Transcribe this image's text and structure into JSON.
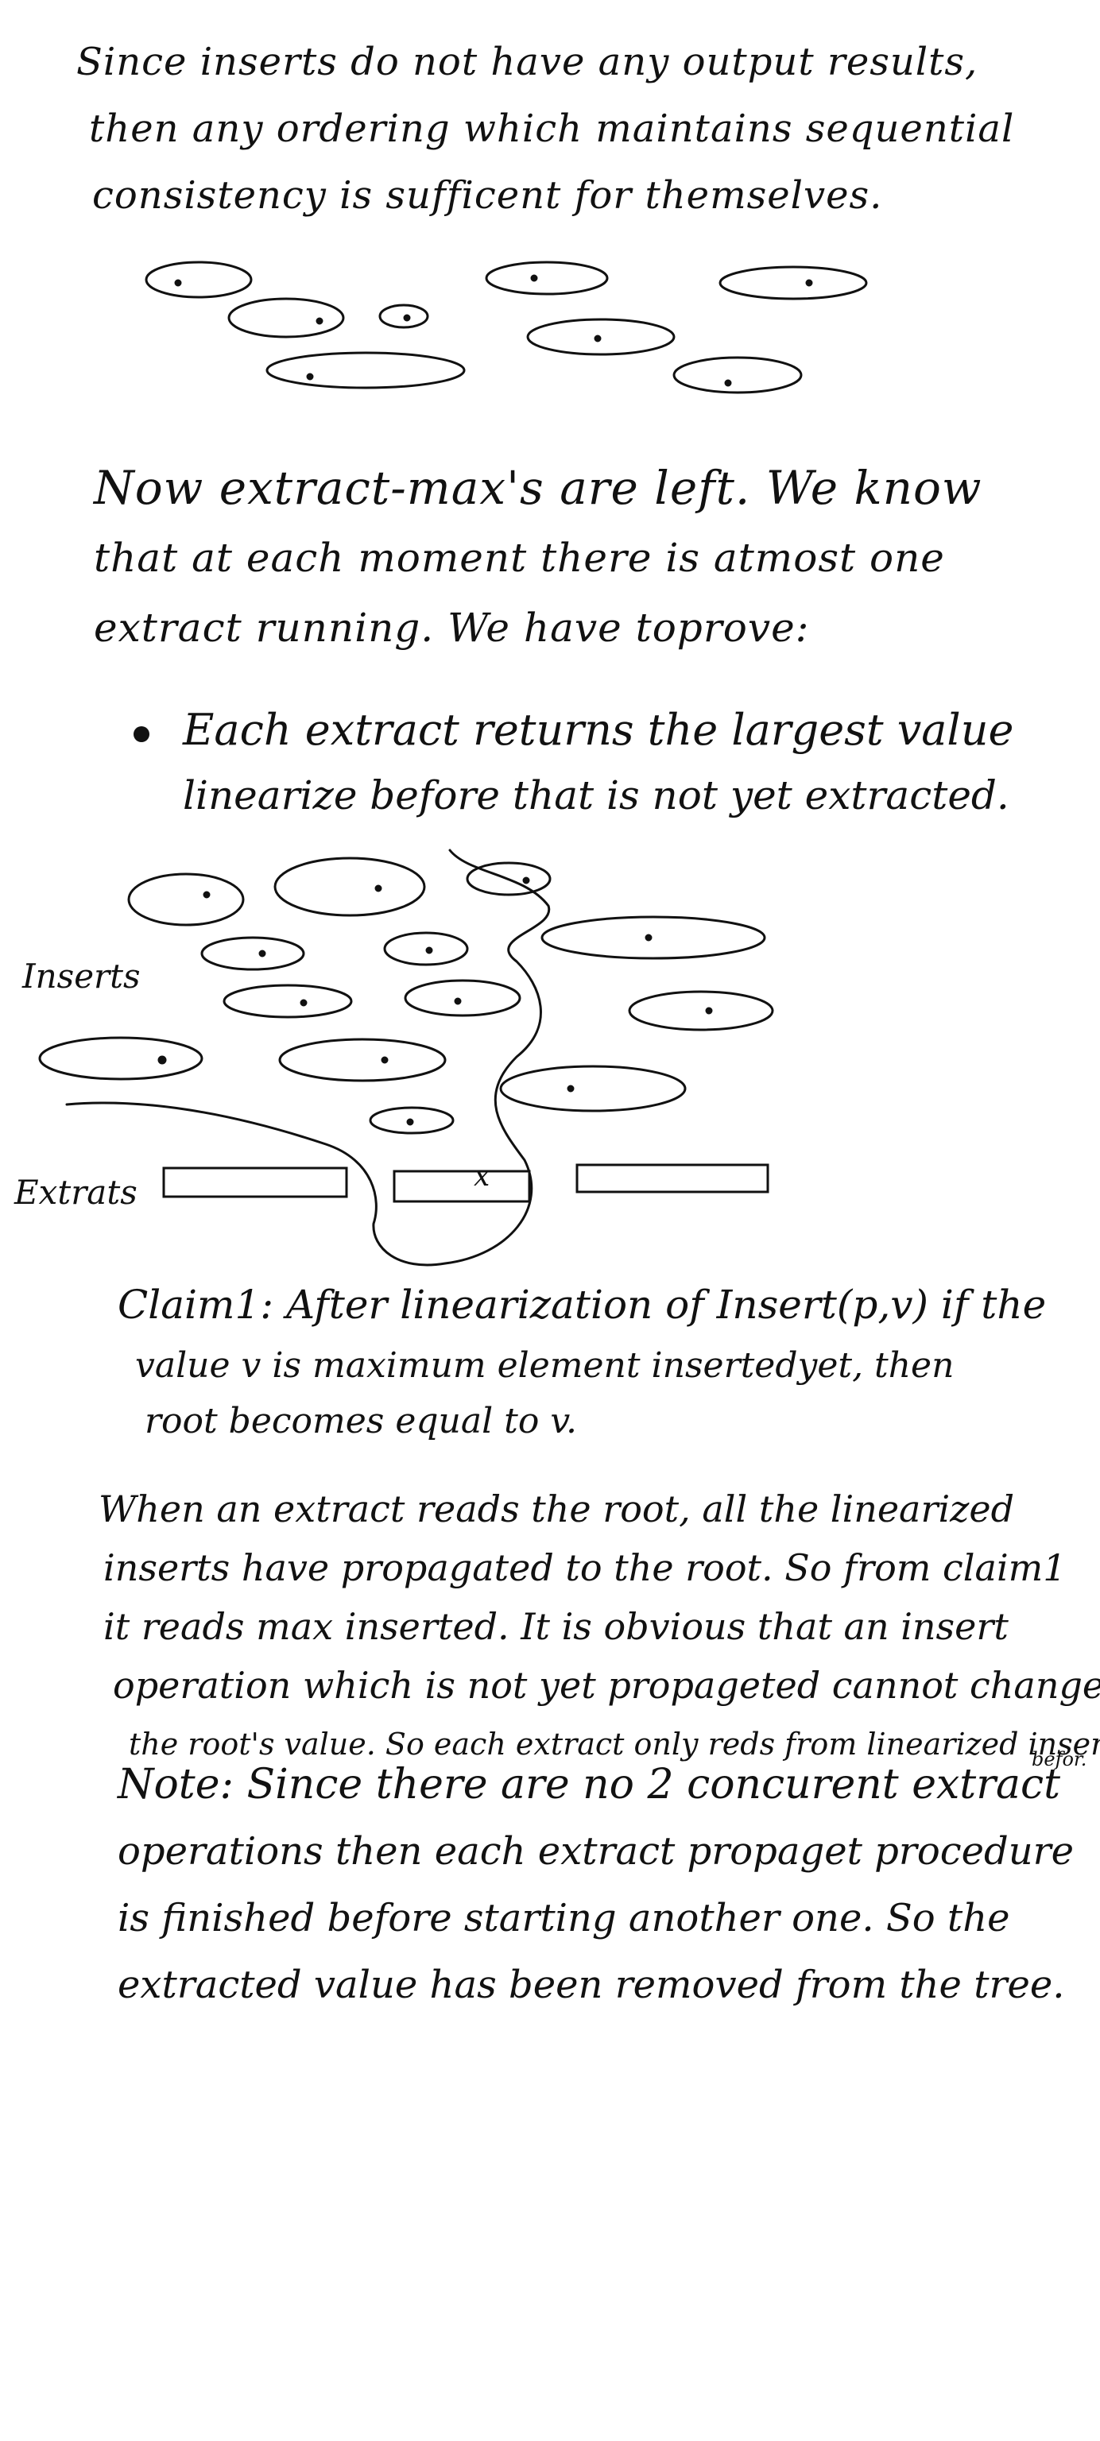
{
  "intro": {
    "lines": [
      "Since inserts do not have any output results,",
      "then any ordering which maintains sequential",
      "consistency is sufficent for themselves."
    ]
  },
  "extract_intro": {
    "lines": [
      "Now extract-max's are left. We know",
      "that at each moment there is atmost one",
      "extract running. We have toprove:"
    ]
  },
  "bullet": {
    "lines": [
      "Each extract returns the largest value",
      "linearize before that is not yet extracted."
    ]
  },
  "diagram": {
    "inserts_label": "Inserts",
    "extracts_label": "Extrats",
    "marker": "x"
  },
  "claim": {
    "lines": [
      "Claim1: After linearization of Insert(p,v) if the",
      "value v is maximum element insertedyet, then",
      "root becomes equal to v."
    ]
  },
  "proof": {
    "lines": [
      "When an extract reads the root, all the linearized",
      "inserts have propagated to the root. So from claim1",
      "it reads max inserted. It is obvious that an insert",
      "operation which is not yet propageted cannot change",
      "the root's value. So each extract only reds from linearized inserts"
    ],
    "trailing_word": "befor."
  },
  "note": {
    "lines": [
      "Note: Since there are no 2 concurent extract",
      "operations then each extract propaget procedure",
      "is finished before starting another one. So the",
      "extracted value has been removed from the tree."
    ]
  }
}
